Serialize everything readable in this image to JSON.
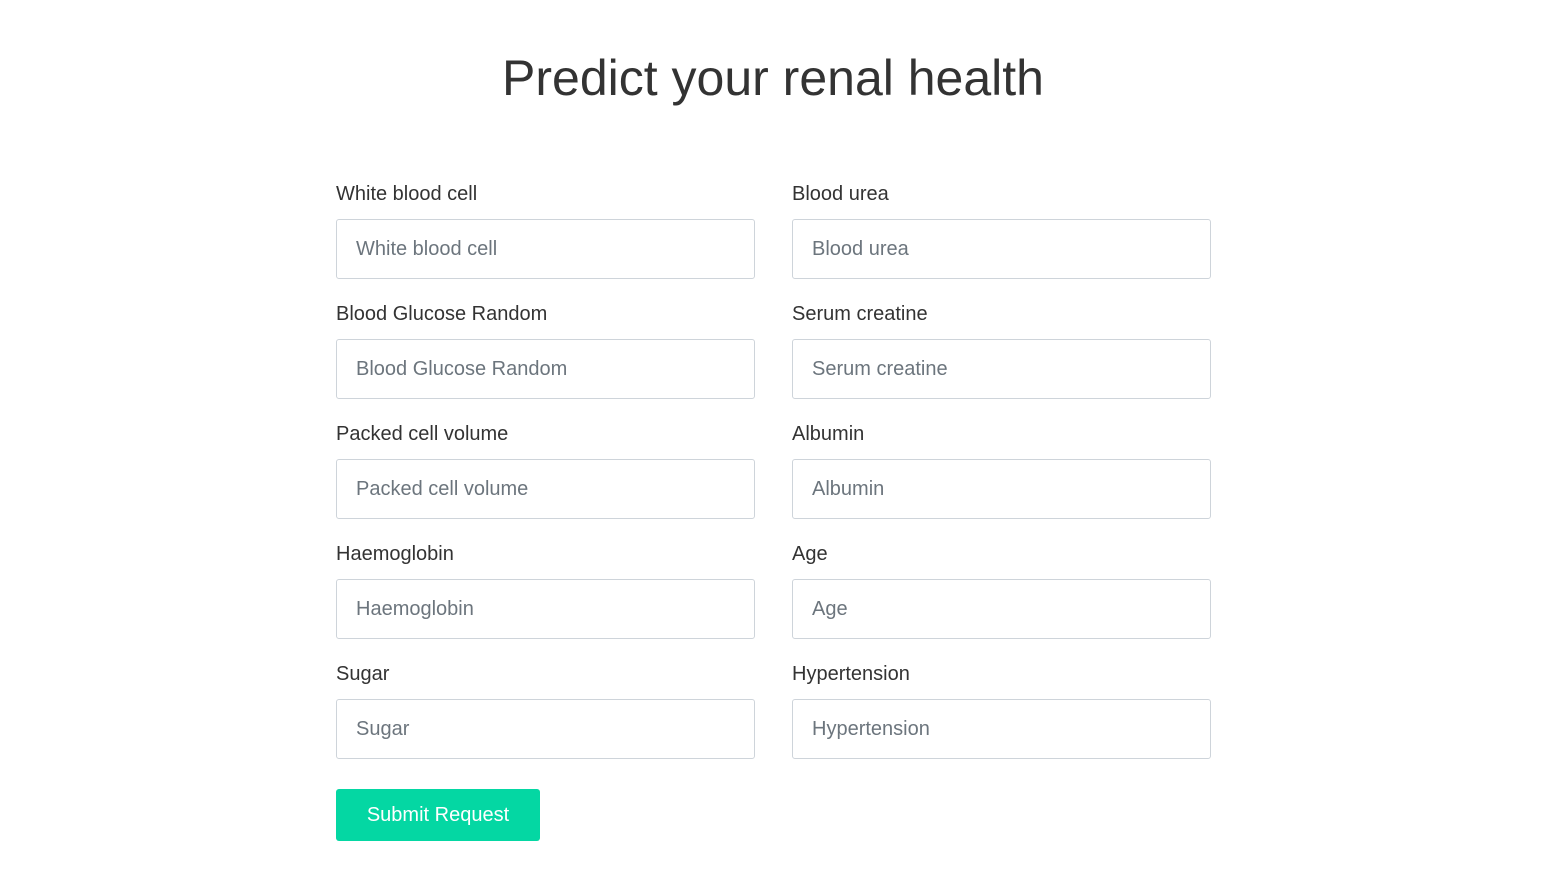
{
  "page": {
    "title": "Predict your renal health"
  },
  "form": {
    "fields": [
      {
        "label": "White blood cell",
        "placeholder": "White blood cell",
        "value": ""
      },
      {
        "label": "Blood urea",
        "placeholder": "Blood urea",
        "value": ""
      },
      {
        "label": "Blood Glucose Random",
        "placeholder": "Blood Glucose Random",
        "value": ""
      },
      {
        "label": "Serum creatine",
        "placeholder": "Serum creatine",
        "value": ""
      },
      {
        "label": "Packed cell volume",
        "placeholder": "Packed cell volume",
        "value": ""
      },
      {
        "label": "Albumin",
        "placeholder": "Albumin",
        "value": ""
      },
      {
        "label": "Haemoglobin",
        "placeholder": "Haemoglobin",
        "value": ""
      },
      {
        "label": "Age",
        "placeholder": "Age",
        "value": ""
      },
      {
        "label": "Sugar",
        "placeholder": "Sugar",
        "value": ""
      },
      {
        "label": "Hypertension",
        "placeholder": "Hypertension",
        "value": ""
      }
    ],
    "submit_label": "Submit Request"
  },
  "colors": {
    "accent": "#04d7a3",
    "text": "#333333",
    "input_border": "#ced4da",
    "placeholder": "#6c757d"
  }
}
